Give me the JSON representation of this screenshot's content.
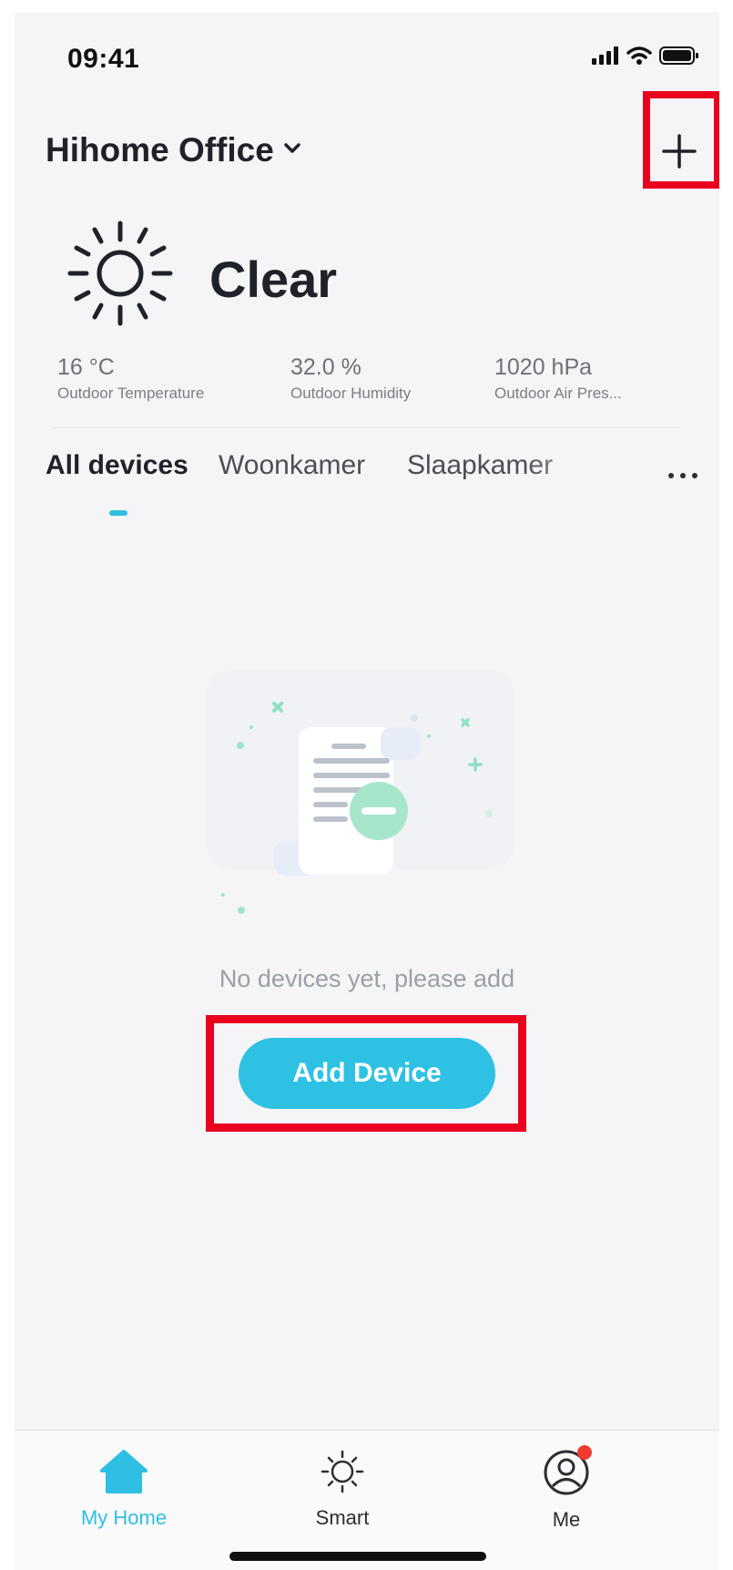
{
  "status_bar": {
    "time": "09:41",
    "icons": [
      "signal-icon",
      "wifi-icon",
      "battery-icon"
    ]
  },
  "header": {
    "home_name": "Hihome Office",
    "dropdown_icon": "chevron-down-icon",
    "add_icon": "plus-icon"
  },
  "weather": {
    "icon": "sun-icon",
    "condition": "Clear",
    "stats": [
      {
        "value": "16 °C",
        "label": "Outdoor Temperature"
      },
      {
        "value": "32.0 %",
        "label": "Outdoor Humidity"
      },
      {
        "value": "1020 hPa",
        "label": "Outdoor Air Pres..."
      }
    ]
  },
  "rooms": {
    "tabs": [
      "All devices",
      "Woonkamer",
      "Slaapkamer"
    ],
    "selected": "All devices",
    "more_icon": "more-icon"
  },
  "empty_state": {
    "illustration": "empty-document-icon",
    "message": "No devices yet, please add",
    "button_label": "Add Device"
  },
  "tab_bar": {
    "items": [
      {
        "label": "My Home",
        "icon": "home-icon",
        "active": true
      },
      {
        "label": "Smart",
        "icon": "sun-icon",
        "active": false
      },
      {
        "label": "Me",
        "icon": "user-icon",
        "active": false,
        "badge": true
      }
    ]
  },
  "colors": {
    "accent": "#2ec1e4",
    "highlight": "#e8001e",
    "badge": "#f23b2f",
    "background": "#f5f5f7"
  }
}
